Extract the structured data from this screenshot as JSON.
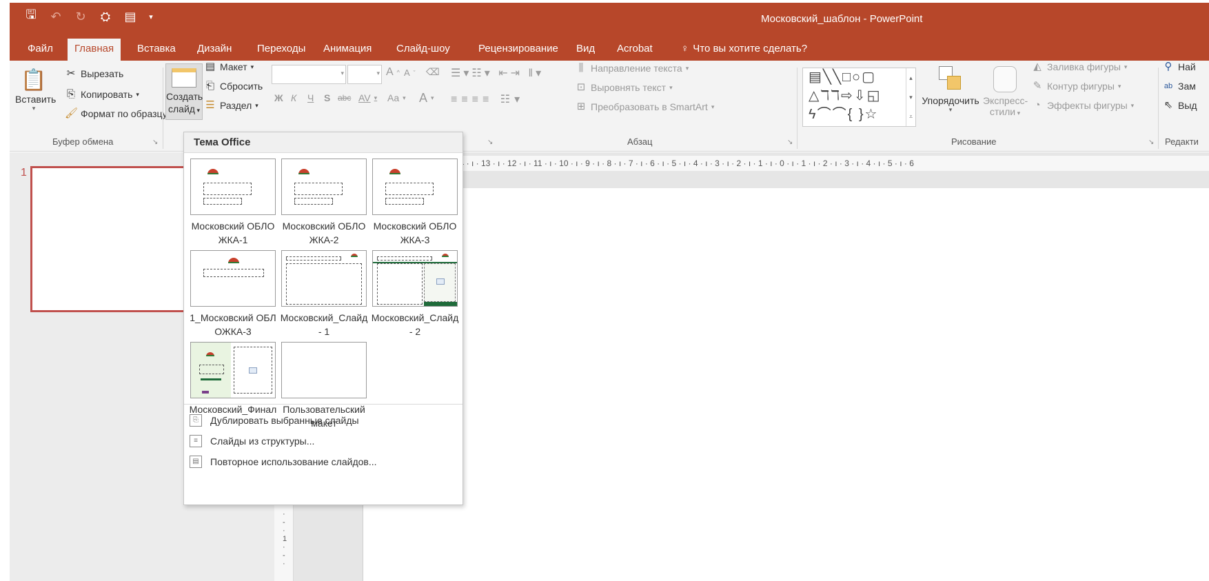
{
  "window": {
    "title": "Московский_шаблон - PowerPoint"
  },
  "qat": {
    "save_icon": "save-icon",
    "undo_icon": "undo-icon",
    "redo_icon": "redo-icon",
    "present_icon": "present-from-start-icon",
    "customize_icon": "customize-qat-icon"
  },
  "tabs": [
    {
      "label": "Файл"
    },
    {
      "label": "Главная"
    },
    {
      "label": "Вставка"
    },
    {
      "label": "Дизайн"
    },
    {
      "label": "Переходы"
    },
    {
      "label": "Анимация"
    },
    {
      "label": "Слайд-шоу"
    },
    {
      "label": "Рецензирование"
    },
    {
      "label": "Вид"
    },
    {
      "label": "Acrobat"
    }
  ],
  "tell_me": "Что вы хотите сделать?",
  "ribbon": {
    "clipboard": {
      "paste": "Вставить",
      "cut": "Вырезать",
      "copy": "Копировать",
      "format_painter": "Формат по образцу",
      "label": "Буфер обмена"
    },
    "slides": {
      "new_slide_line1": "Создать",
      "new_slide_line2": "слайд",
      "layout": "Макет",
      "reset": "Сбросить",
      "section": "Раздел"
    },
    "font": {
      "bold": "Ж",
      "italic": "К",
      "underline": "Ч",
      "shadow": "S",
      "strike": "abc",
      "spacing": "AV",
      "case": "Aa",
      "grow": "A",
      "shrink": "A",
      "color": "A"
    },
    "paragraph": {
      "text_direction": "Направление текста",
      "align_text": "Выровнять текст",
      "smartart": "Преобразовать в SmartArt",
      "label": "Абзац"
    },
    "drawing": {
      "arrange": "Упорядочить",
      "quick_styles_1": "Экспресс-",
      "quick_styles_2": "стили",
      "fill": "Заливка фигуры",
      "outline": "Контур фигуры",
      "effects": "Эффекты фигуры",
      "label": "Рисование"
    },
    "editing": {
      "find": "Най",
      "replace": "Зам",
      "select": "Выд",
      "label": "Редакти"
    }
  },
  "slide_panel": {
    "slide_number": "1"
  },
  "ruler": {
    "horizontal": "14 · ı · 13 · ı · 12 · ı · 11 · ı · 10 · ı · 9 · ı · 8 · ı · 7 · ı · 6 · ı · 5 · ı · 4 · ı · 3 · ı · 2 · ı · 1 · ı · 0 · ı · 1 · ı · 2 · ı · 3 · ı · 4 · ı · 5 · ı · 6",
    "vertical_label": "1"
  },
  "gallery": {
    "header": "Тема Office",
    "layouts": [
      {
        "name": "Московский ОБЛОЖКА-1"
      },
      {
        "name": "Московский ОБЛОЖКА-2"
      },
      {
        "name": "Московский ОБЛОЖКА-3"
      },
      {
        "name": "1_Московский ОБЛОЖКА-3"
      },
      {
        "name": "Московский_Слайд - 1"
      },
      {
        "name": "Московский_Слайд - 2"
      },
      {
        "name": "Московский_Финал"
      },
      {
        "name": "Пользовательский макет"
      }
    ],
    "commands": [
      {
        "label": "Дублировать выбранные слайды"
      },
      {
        "label": "Слайды из структуры..."
      },
      {
        "label": "Повторное использование слайдов..."
      }
    ]
  }
}
